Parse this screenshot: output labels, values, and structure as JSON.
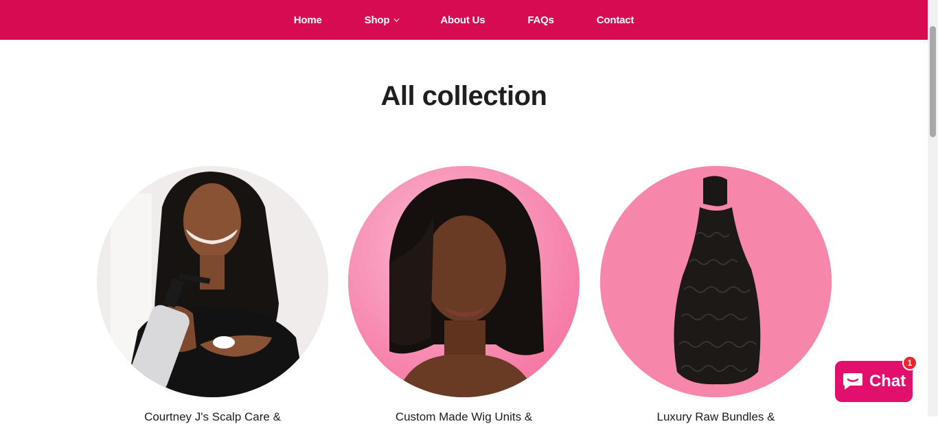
{
  "nav": {
    "items": [
      {
        "label": "Home"
      },
      {
        "label": "Shop"
      },
      {
        "label": "About Us"
      },
      {
        "label": "FAQs"
      },
      {
        "label": "Contact"
      }
    ]
  },
  "page": {
    "title": "All collection"
  },
  "collections": [
    {
      "title": "Courtney J's Scalp Care &",
      "image": "woman-applying-scalp-care-product"
    },
    {
      "title": "Custom Made Wig Units &",
      "image": "woman-with-bob-wig"
    },
    {
      "title": "Luxury Raw Bundles &",
      "image": "curly-hair-bundle"
    }
  ],
  "chat": {
    "label": "Chat",
    "badge": "1"
  },
  "colors": {
    "brand": "#d60b51",
    "chat": "#e0106c",
    "badge": "#e8262d"
  }
}
